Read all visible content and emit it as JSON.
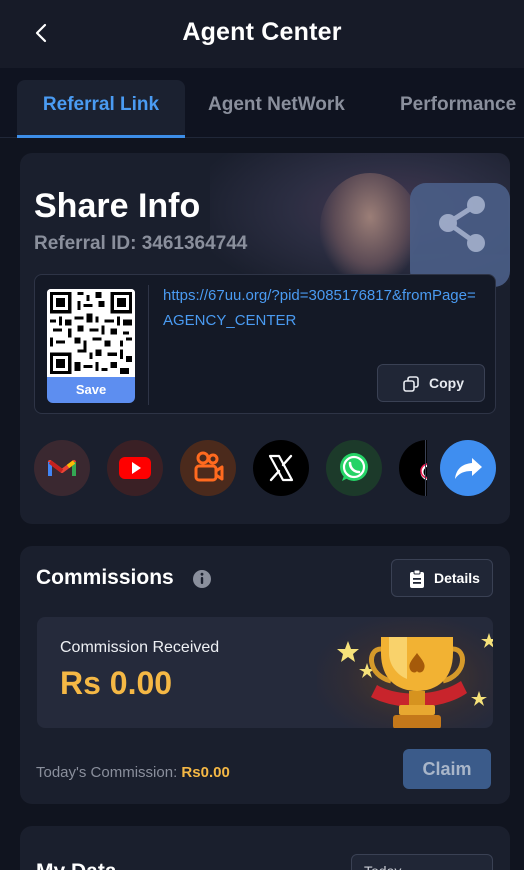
{
  "header": {
    "title": "Agent Center"
  },
  "tabs": [
    {
      "label": "Referral Link",
      "active": true
    },
    {
      "label": "Agent NetWork",
      "active": false
    },
    {
      "label": "Performance",
      "active": false
    }
  ],
  "share": {
    "title": "Share Info",
    "referral_id_text": "Referral ID: 3461364744",
    "qr_save_label": "Save",
    "url": "https://67uu.org/?pid=3085176817&fromPage=AGENCY_CENTER",
    "copy_label": "Copy",
    "socials": [
      "gmail-icon",
      "youtube-icon",
      "kwai-icon",
      "x-icon",
      "whatsapp-icon",
      "tiktok-icon",
      "share-icon"
    ]
  },
  "commissions": {
    "title": "Commissions",
    "details_label": "Details",
    "received_label": "Commission Received",
    "received_value": "Rs 0.00",
    "today_label": "Today's Commission:",
    "today_value": "Rs0.00",
    "claim_label": "Claim"
  },
  "mydata": {
    "title": "My Data",
    "period": "Today"
  },
  "colors": {
    "accent": "#4a9bf2",
    "gold": "#f5b845",
    "background": "#10141f",
    "card": "#1a1f2d"
  }
}
